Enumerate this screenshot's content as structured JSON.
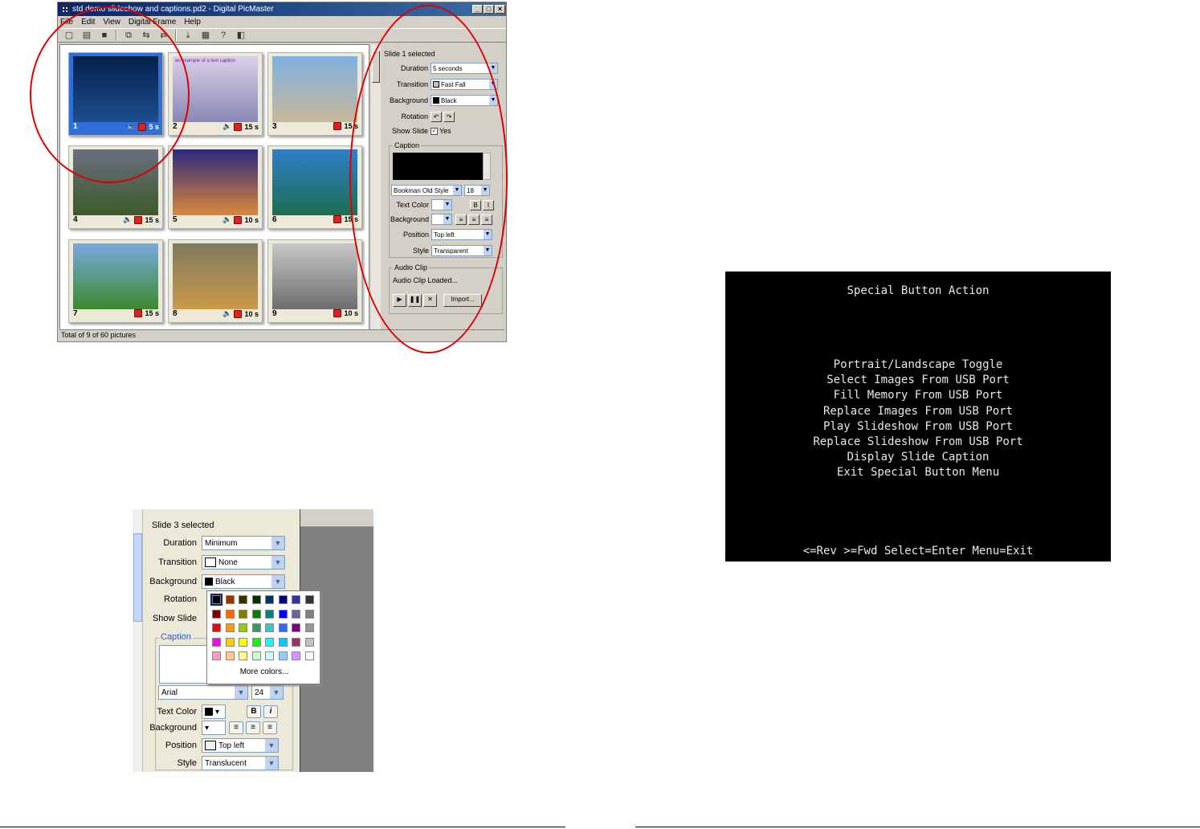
{
  "app": {
    "title": "std demo slideshow and captions.pd2 - Digital PicMaster",
    "window_buttons": [
      "_",
      "□",
      "×"
    ],
    "menu": [
      "File",
      "Edit",
      "View",
      "Digital Frame",
      "Help"
    ],
    "status": "Total of 9 of 60 pictures"
  },
  "slides": [
    {
      "num": "1",
      "audio": true,
      "duration": "5 s",
      "selected": true,
      "colors": [
        "#05204a",
        "#1a4f8f"
      ]
    },
    {
      "num": "2",
      "audio": true,
      "duration": "15 s",
      "selected": false,
      "caption": "an example of a text caption",
      "colors": [
        "#d9cfe8",
        "#8a88b8"
      ]
    },
    {
      "num": "3",
      "audio": false,
      "duration": "15 s",
      "selected": false,
      "colors": [
        "#7fb2e0",
        "#c7b79a"
      ]
    },
    {
      "num": "4",
      "audio": true,
      "duration": "15 s",
      "selected": false,
      "colors": [
        "#6a6f80",
        "#3d5a2a"
      ]
    },
    {
      "num": "5",
      "audio": true,
      "duration": "10 s",
      "selected": false,
      "colors": [
        "#2d2a80",
        "#d9873a"
      ]
    },
    {
      "num": "6",
      "audio": false,
      "duration": "15 s",
      "selected": false,
      "colors": [
        "#2f7fc8",
        "#1e6d50"
      ]
    },
    {
      "num": "7",
      "audio": false,
      "duration": "15 s",
      "selected": false,
      "colors": [
        "#7aa8e0",
        "#3c8a2c"
      ]
    },
    {
      "num": "8",
      "audio": true,
      "duration": "10 s",
      "selected": false,
      "colors": [
        "#7f7a60",
        "#c89a4a"
      ]
    },
    {
      "num": "9",
      "audio": false,
      "duration": "10 s",
      "selected": false,
      "colors": [
        "#c8c8c8",
        "#6d6d6d"
      ]
    }
  ],
  "panel": {
    "selected": "Slide 1 selected",
    "duration_label": "Duration",
    "duration_value": "5 seconds",
    "transition_label": "Transition",
    "transition_value": "Fast Fall",
    "background_label": "Background",
    "background_value": "Black",
    "rotation_label": "Rotation",
    "showslide_label": "Show Slide",
    "showslide_value": "Yes",
    "caption_group": "Caption",
    "font_value": "Bookman Old Style",
    "size_value": "18",
    "textcolor_label": "Text Color",
    "capbg_label": "Background",
    "position_label": "Position",
    "position_value": "Top left",
    "style_label": "Style",
    "style_value": "Transparent",
    "audio_group": "Audio Clip",
    "audio_status": "Audio Clip Loaded...",
    "import_label": "Import..."
  },
  "zoom": {
    "selected": "Slide 3 selected",
    "duration_label": "Duration",
    "duration_value": "Minimum",
    "transition_label": "Transition",
    "transition_value": "None",
    "background_label": "Background",
    "background_value": "Black",
    "rotation_label": "Rotation",
    "showslide_label": "Show Slide",
    "caption_group": "Caption",
    "font_value": "Arial",
    "size_value": "24",
    "textcolor_label": "Text Color",
    "capbg_label": "Background",
    "position_label": "Position",
    "position_value": "Top left",
    "style_label": "Style",
    "style_value": "Translucent",
    "more_colors": "More colors...",
    "palette": [
      [
        "#000000",
        "#993300",
        "#333300",
        "#003300",
        "#003366",
        "#000080",
        "#333399",
        "#333333"
      ],
      [
        "#800000",
        "#ff6600",
        "#808000",
        "#008000",
        "#008080",
        "#0000ff",
        "#666699",
        "#808080"
      ],
      [
        "#ff0000",
        "#ff9900",
        "#99cc00",
        "#339966",
        "#33cccc",
        "#3366ff",
        "#800080",
        "#969696"
      ],
      [
        "#ff00ff",
        "#ffcc00",
        "#ffff00",
        "#00ff00",
        "#00ffff",
        "#00ccff",
        "#993366",
        "#c0c0c0"
      ],
      [
        "#ff99cc",
        "#ffcc99",
        "#ffff99",
        "#ccffcc",
        "#ccffff",
        "#99ccff",
        "#cc99ff",
        "#ffffff"
      ]
    ]
  },
  "menu_screen": {
    "title": "Special Button Action",
    "items": [
      "Portrait/Landscape Toggle",
      "Select Images From USB Port",
      "Fill Memory From USB Port",
      "Replace Images From USB Port",
      "Play Slideshow From USB Port",
      "Replace Slideshow From USB Port",
      "Display Slide Caption",
      "Exit Special Button Menu"
    ],
    "footer": "<=Rev >=Fwd Select=Enter Menu=Exit"
  },
  "colors": {
    "annotation": "#e00000",
    "selection": "#2f6fd8",
    "title_bar": "#0a246a"
  }
}
